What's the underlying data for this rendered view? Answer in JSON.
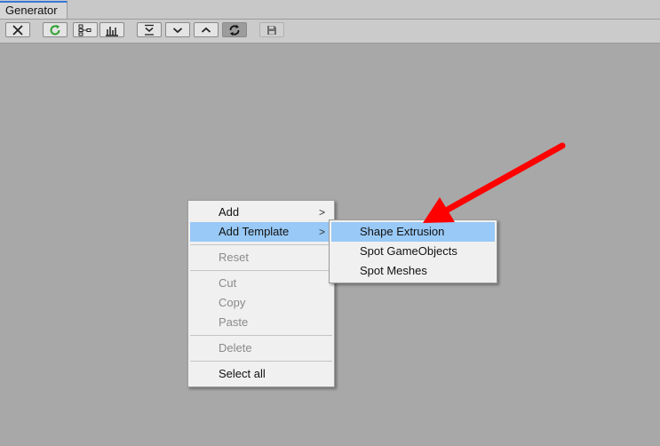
{
  "window": {
    "tab_title": "Generator"
  },
  "toolbar": {
    "buttons": [
      {
        "name": "close-icon"
      },
      {
        "name": "refresh-icon",
        "color": "#2ea12e"
      },
      {
        "name": "hierarchy-icon"
      },
      {
        "name": "bar-chart-icon"
      },
      {
        "name": "collapse-all-icon"
      },
      {
        "name": "chevron-down-icon"
      },
      {
        "name": "chevron-up-icon"
      },
      {
        "name": "sync-icon",
        "state": "active"
      },
      {
        "name": "save-icon",
        "state": "disabled"
      }
    ]
  },
  "context_menu": {
    "items": [
      {
        "label": "Add",
        "has_submenu": true
      },
      {
        "label": "Add Template",
        "has_submenu": true,
        "highlighted": true
      },
      {
        "label": "Reset",
        "disabled": true
      },
      {
        "label": "Cut",
        "disabled": true
      },
      {
        "label": "Copy",
        "disabled": true
      },
      {
        "label": "Paste",
        "disabled": true
      },
      {
        "label": "Delete",
        "disabled": true
      },
      {
        "label": "Select all"
      }
    ],
    "submenu_arrow": ">"
  },
  "submenu": {
    "items": [
      {
        "label": "Shape Extrusion",
        "highlighted": true
      },
      {
        "label": "Spot GameObjects"
      },
      {
        "label": "Spot Meshes"
      }
    ]
  },
  "colors": {
    "background": "#a8a8a8",
    "highlight": "#99c9f6",
    "annotation_arrow": "#ff0000"
  }
}
